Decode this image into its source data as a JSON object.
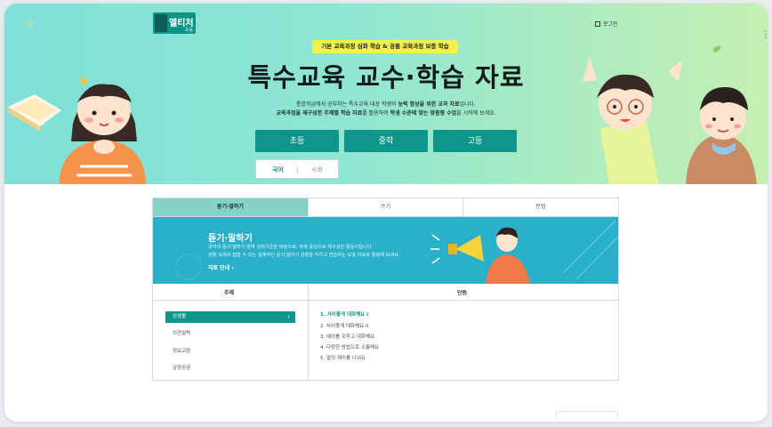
{
  "logo": {
    "text": "엘티처",
    "sub": "초등"
  },
  "header": {
    "login": "로그인"
  },
  "hero": {
    "badge": "기본 교육과정 심화 학습 & 공통 교육과정 보충 학습",
    "title": "특수교육 교수·학습 자료",
    "desc_line1_a": "통합학급에서 공부하는 특수교육 대상 학생의 ",
    "desc_line1_b": "능력 향상을 위한 교과 자료",
    "desc_line1_c": "입니다.",
    "desc_line2_a": "교육과정을 재구성한 주제별 학습 자료",
    "desc_line2_b": "를 활용하여 ",
    "desc_line2_c": "학생 수준에 맞는 맞춤형 수업",
    "desc_line2_d": "을 시작해 보세요.",
    "levels": [
      "초등",
      "중학",
      "고등"
    ],
    "subjects": [
      "국어",
      "사회"
    ]
  },
  "content": {
    "tabs": [
      "듣기·말하기",
      "쓰기",
      "문법"
    ],
    "banner": {
      "title": "듣기·말하기",
      "line1": "국어과 듣기·말하기 영역 성취기준을 바탕으로, 주제 중심으로 재구성한 활동지입니다.",
      "line2": "생활 속에서 접할 수 있는 실제적인 듣기·말하기 상황을 익히고 연습하는 보충 자료로 활용해 보세요.",
      "more": "자료 안내 ›"
    },
    "col_topic": "주제",
    "col_unit": "단원",
    "topics": [
      "상생활",
      "의견설득",
      "정보교환",
      "감정공감"
    ],
    "units": [
      "1. 사이좋게 대화해요 I",
      "2. 사이좋게 대화해요 II",
      "3. 예의를 갖추고 대화해요",
      "4. 다양한 방법으로 소통해요",
      "5. 말의 재미를 나눠요"
    ]
  },
  "colors": {
    "primary": "#0f968a",
    "badge": "#f7ef4a",
    "banner": "#2bb0ca",
    "tab_active": "#85d3c8"
  }
}
